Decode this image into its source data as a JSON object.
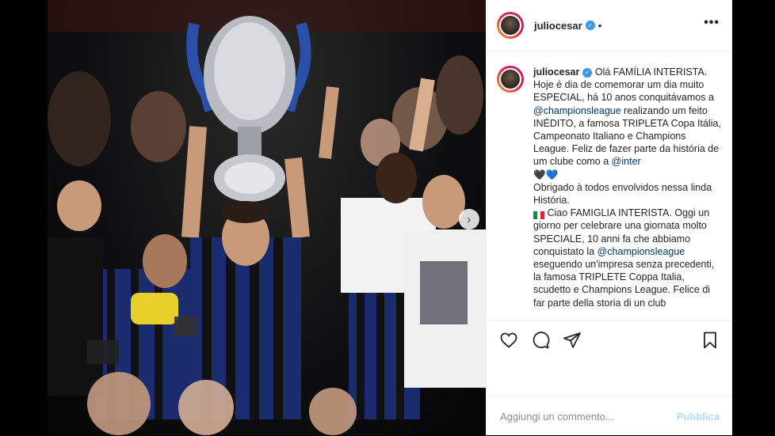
{
  "post": {
    "username": "juliocesar",
    "more_glyph": "•••",
    "dot_glyph": "•"
  },
  "caption": {
    "username": "juliocesar",
    "pt_part1": " Olá FAMÍLIA INTERISTA. Hoje é dia de comemorar um dia muito ESPECIAL, há 10 anos conquitávamos a ",
    "pt_mention1": "@championsleague",
    "pt_part2": " realizando um feito INÉDITO, a famosa TRIPLETA Copa Itália, Campeonato Italiano e Champions League. Feliz de fazer parte da história de um clube como a ",
    "pt_mention2": "@inter",
    "hearts": {
      "black": "🖤",
      "blue": "💙"
    },
    "pt_thanks": "Obrigado à todos envolvidos nessa linda História.",
    "it_part1": " Ciao FAMIGLIA INTERISTA. Oggi un giorno per celebrare una giornata molto SPECIALE, 10 anni fa che abbiamo conquistato la ",
    "it_mention": "@championsleague",
    "it_part2": " eseguendo un'impresa senza precedenti, la famosa TRIPLETE Coppa Italia, scudetto e Champions League. Felice di far parte della storia di un club"
  },
  "icons": {
    "like": "heart-icon",
    "comment": "comment-icon",
    "share": "share-icon",
    "save": "bookmark-icon",
    "verified": "verified-badge-icon",
    "carousel_next": "chevron-right-icon",
    "flag": "italy-flag-icon"
  },
  "comment": {
    "placeholder": "Aggiungi un commento...",
    "publish_label": "Pubblica"
  },
  "carousel": {
    "next_glyph": "›"
  },
  "colors": {
    "link": "#00376b",
    "verified": "#3897f0",
    "publish_disabled": "#b3dbff",
    "border": "#efefef"
  }
}
